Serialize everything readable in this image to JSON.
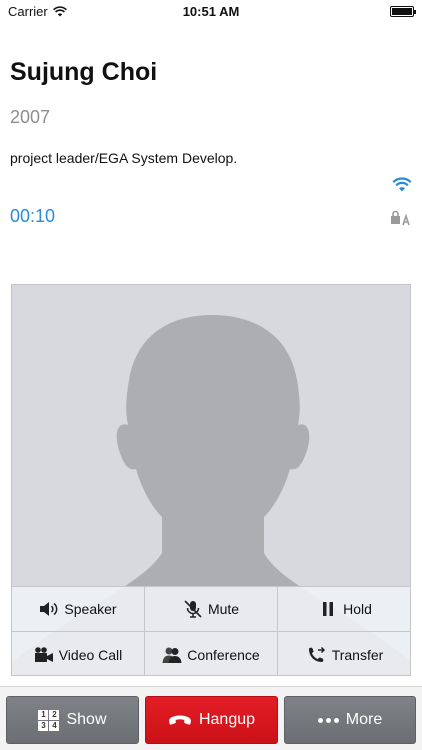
{
  "status_bar": {
    "carrier": "Carrier",
    "time": "10:51 AM"
  },
  "caller": {
    "name": "Sujung Choi",
    "extension": "2007",
    "title": "project leader/EGA System Develop.",
    "timer": "00:10"
  },
  "colors": {
    "accent": "#2a8bd6",
    "hangup": "#d8161d",
    "button_gray": "#75787d"
  },
  "call_controls": [
    {
      "label": "Speaker",
      "icon": "speaker-icon"
    },
    {
      "label": "Mute",
      "icon": "mic-off-icon"
    },
    {
      "label": "Hold",
      "icon": "pause-icon"
    },
    {
      "label": "Video Call",
      "icon": "video-camera-icon"
    },
    {
      "label": "Conference",
      "icon": "conference-icon"
    },
    {
      "label": "Transfer",
      "icon": "transfer-icon"
    }
  ],
  "bottom_bar": {
    "show_label": "Show",
    "keypad_digits": [
      "1",
      "2",
      "3",
      "4"
    ],
    "hangup_label": "Hangup",
    "more_label": "More"
  }
}
